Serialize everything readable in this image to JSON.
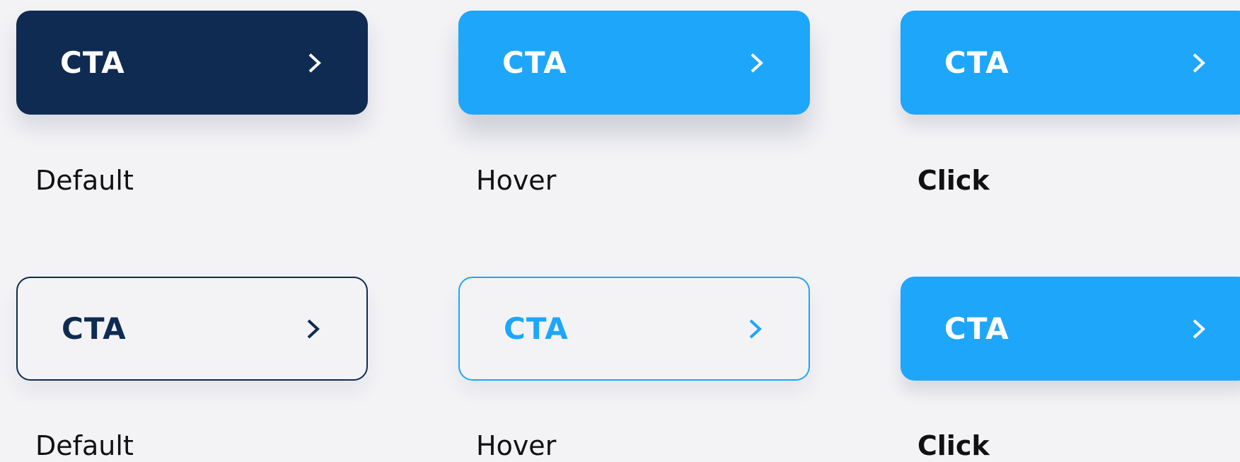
{
  "rows": [
    {
      "buttons": [
        {
          "label": "CTA",
          "icon": "chevron-right-icon",
          "style": "solid",
          "color": "#0f2b52",
          "text_color": "#ffffff"
        },
        {
          "label": "CTA",
          "icon": "chevron-right-icon",
          "style": "solid",
          "color": "#1ea6fa",
          "text_color": "#ffffff"
        },
        {
          "label": "CTA",
          "icon": "chevron-right-icon",
          "style": "solid",
          "color": "#1ea6fa",
          "text_color": "#ffffff"
        }
      ],
      "states": [
        "Default",
        "Hover",
        "Click"
      ]
    },
    {
      "buttons": [
        {
          "label": "CTA",
          "icon": "chevron-right-icon",
          "style": "outline",
          "color": "#0f2b52",
          "text_color": "#0f2b52"
        },
        {
          "label": "CTA",
          "icon": "chevron-right-icon",
          "style": "outline",
          "color": "#1ea6fa",
          "text_color": "#1ea6fa"
        },
        {
          "label": "CTA",
          "icon": "chevron-right-icon",
          "style": "solid",
          "color": "#1ea6fa",
          "text_color": "#ffffff"
        }
      ],
      "states": [
        "Default",
        "Hover",
        "Click"
      ]
    }
  ],
  "colors": {
    "background": "#f3f3f6",
    "navy": "#0f2b52",
    "blue": "#1ea6fa",
    "label_text": "#111111"
  }
}
